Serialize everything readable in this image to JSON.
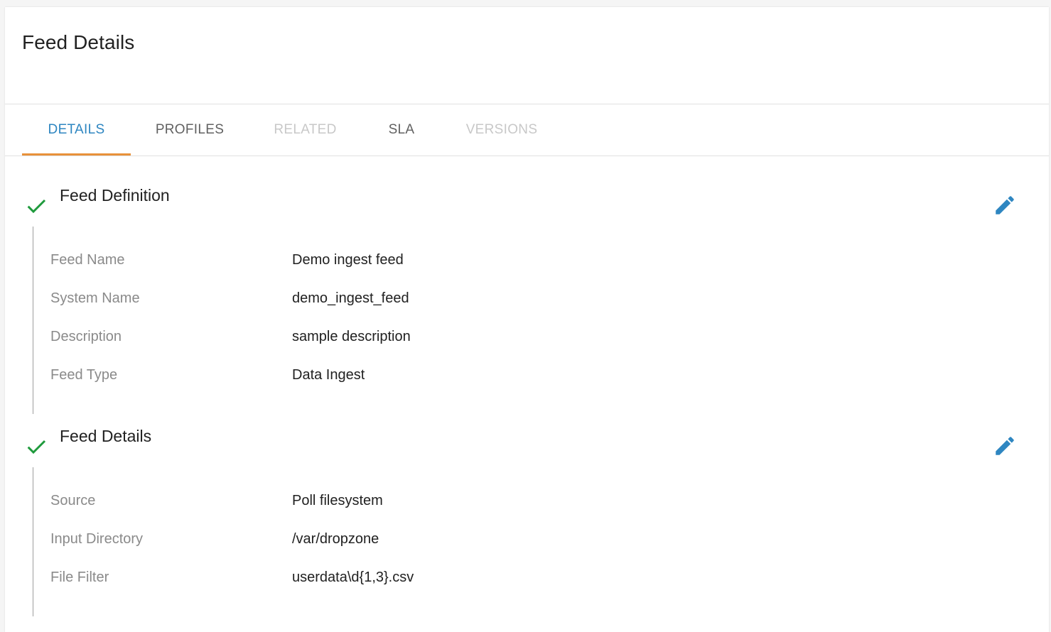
{
  "page": {
    "title": "Feed Details"
  },
  "tabs": [
    {
      "label": "DETAILS",
      "state": "active"
    },
    {
      "label": "PROFILES",
      "state": "enabled"
    },
    {
      "label": "RELATED",
      "state": "disabled"
    },
    {
      "label": "SLA",
      "state": "enabled"
    },
    {
      "label": "VERSIONS",
      "state": "disabled"
    }
  ],
  "sections": [
    {
      "title": "Feed Definition",
      "status_icon": "check-icon",
      "action_icon": "edit-pencil-icon",
      "fields": [
        {
          "label": "Feed Name",
          "value": "Demo ingest feed"
        },
        {
          "label": "System Name",
          "value": "demo_ingest_feed"
        },
        {
          "label": "Description",
          "value": "sample description"
        },
        {
          "label": "Feed Type",
          "value": "Data Ingest"
        }
      ]
    },
    {
      "title": "Feed Details",
      "status_icon": "check-icon",
      "action_icon": "edit-pencil-icon",
      "fields": [
        {
          "label": "Source",
          "value": "Poll filesystem"
        },
        {
          "label": "Input Directory",
          "value": "/var/dropzone"
        },
        {
          "label": "File Filter",
          "value": "userdata\\d{1,3}.csv"
        }
      ]
    }
  ],
  "colors": {
    "accent": "#2e86c1",
    "tab_indicator": "#e8913a",
    "check": "#1e9a3c",
    "edit_icon": "#2e86c1"
  }
}
